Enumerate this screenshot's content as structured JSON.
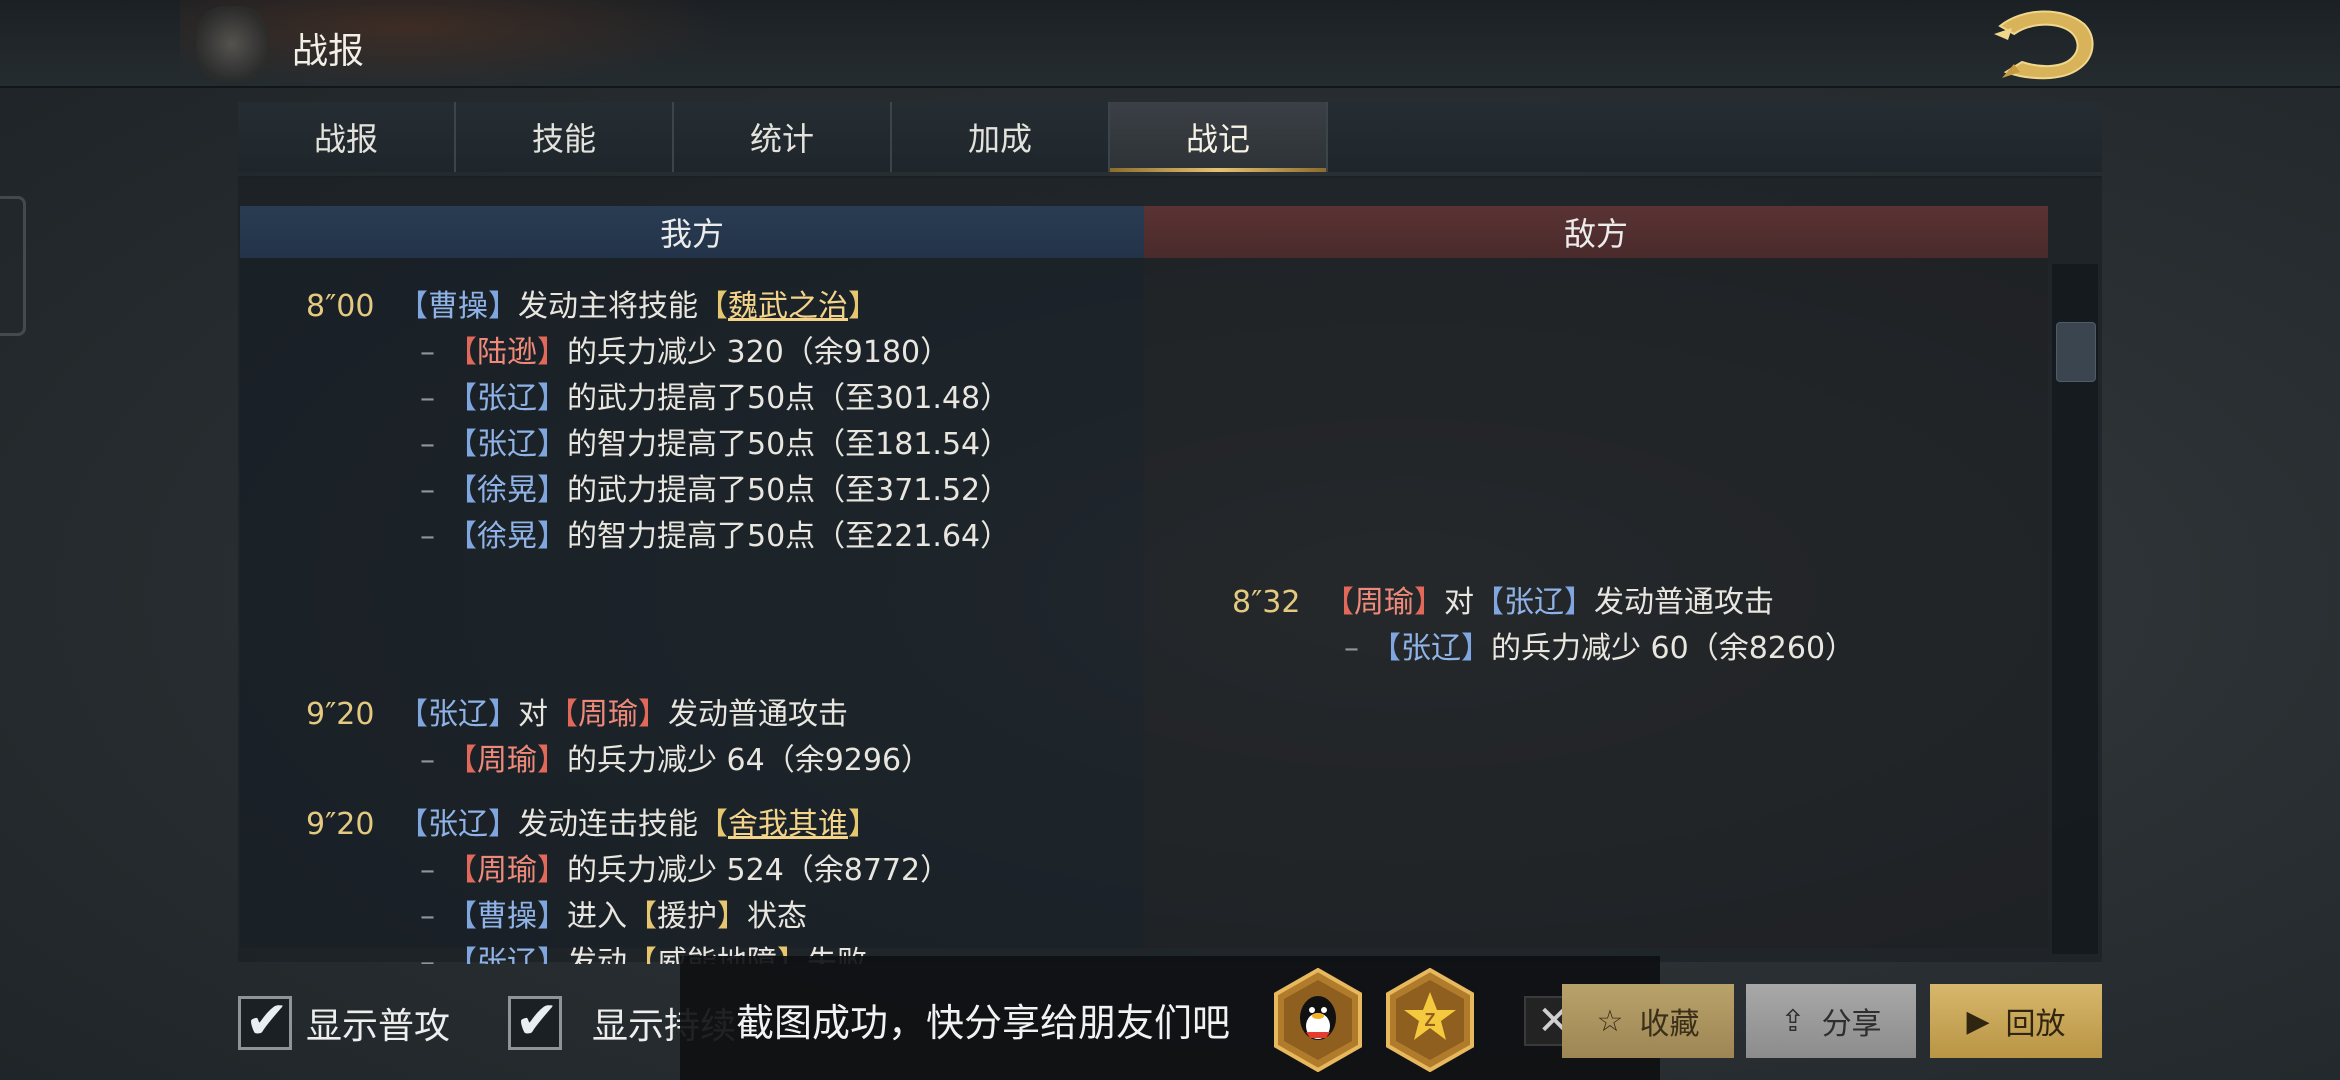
{
  "header": {
    "title": "战报"
  },
  "tabs": [
    {
      "label": "战报"
    },
    {
      "label": "技能"
    },
    {
      "label": "统计"
    },
    {
      "label": "加成"
    },
    {
      "label": "战记"
    }
  ],
  "sides": {
    "ours": "我方",
    "enemy": "敌方"
  },
  "log": {
    "e1": {
      "time": "8″00",
      "actor": "曹操",
      "text": "发动主将技能",
      "skill": "魏武之治",
      "subs": [
        {
          "target": "陆逊",
          "color": "red",
          "text": "的兵力减少 320（余9180）"
        },
        {
          "target": "张辽",
          "color": "blue",
          "text": "的武力提高了50点（至301.48）"
        },
        {
          "target": "张辽",
          "color": "blue",
          "text": "的智力提高了50点（至181.54）"
        },
        {
          "target": "徐晃",
          "color": "blue",
          "text": "的武力提高了50点（至371.52）"
        },
        {
          "target": "徐晃",
          "color": "blue",
          "text": "的智力提高了50点（至221.64）"
        }
      ]
    },
    "e2": {
      "time": "8″32",
      "actor": "周瑜",
      "mid": "对",
      "target": "张辽",
      "text": "发动普通攻击",
      "sub": {
        "target": "张辽",
        "text": "的兵力减少 60（余8260）"
      }
    },
    "e3": {
      "time": "9″20",
      "actor": "张辽",
      "mid": "对",
      "target": "周瑜",
      "text": "发动普通攻击",
      "sub": {
        "target": "周瑜",
        "text": "的兵力减少 64（余9296）"
      }
    },
    "e4": {
      "time": "9″20",
      "actor": "张辽",
      "text": "发动连击技能",
      "skill": "舍我其谁",
      "subs": [
        {
          "target": "周瑜",
          "color": "red",
          "text": "的兵力减少 524（余8772）"
        },
        {
          "target": "曹操",
          "color": "blue",
          "pre": "进入",
          "state": "援护",
          "post": "状态"
        },
        {
          "target": "张辽",
          "color": "blue",
          "pre": "发动",
          "state": "威能地障",
          "post": "失败"
        }
      ]
    }
  },
  "options": {
    "show_normal_attack": "显示普攻",
    "show_persist": "显示持续"
  },
  "toast": {
    "text": "截图成功，快分享给朋友们吧"
  },
  "share_icons": [
    {
      "name": "qq-icon"
    },
    {
      "name": "qzone-icon"
    }
  ],
  "buttons": {
    "favorite": "收藏",
    "share": "分享",
    "replay": "回放"
  },
  "colors": {
    "gold": "#e6c770",
    "ally": "#7fa6df",
    "enemy": "#e2685a"
  }
}
